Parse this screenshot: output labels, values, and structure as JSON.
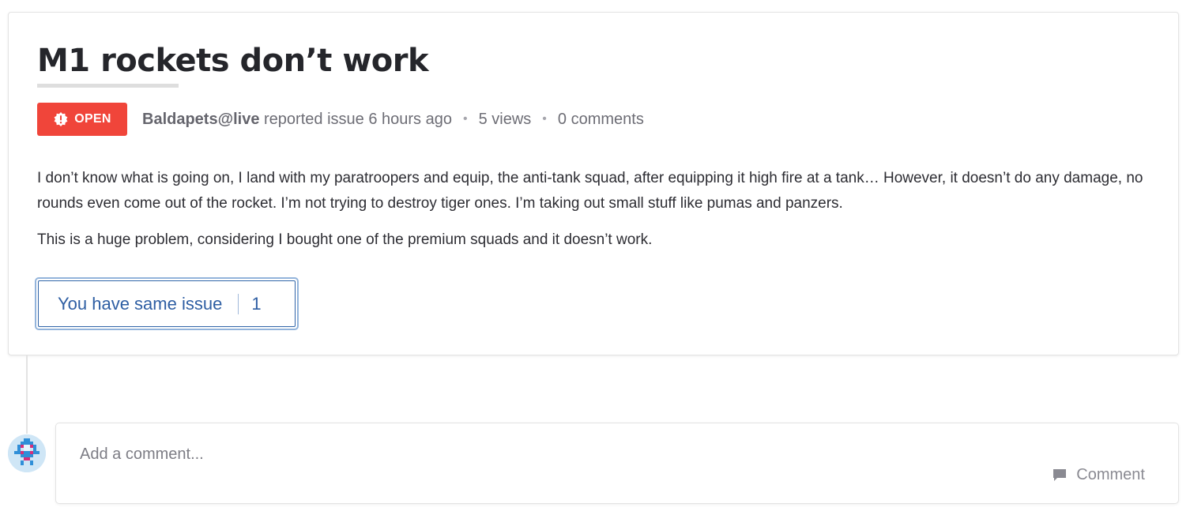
{
  "issue": {
    "title": "M1 rockets don’t work",
    "status_label": "OPEN",
    "status_color": "#f0453a",
    "author": "Baldapets@live",
    "action_text": "reported issue",
    "time_ago": "6 hours ago",
    "views": "5 views",
    "comments": "0 comments",
    "separator": "•",
    "body_paragraphs": [
      "I don’t know what is going on, I land with my paratroopers and equip, the anti-tank squad, after equipping it high fire at a tank… However, it doesn’t do any damage, no rounds even come out of the rocket. I’m not trying to destroy tiger ones. I’m taking out small stuff like pumas and panzers.",
      "This is a huge problem, considering I bought one of the premium squads and it doesn’t work."
    ]
  },
  "same_issue": {
    "label": "You have same issue",
    "count": "1",
    "accent": "#2e5ea3"
  },
  "comment_form": {
    "placeholder": "Add a comment...",
    "value": "",
    "submit_label": "Comment",
    "submit_icon": "speech-bubble-icon"
  },
  "avatar": {
    "icon": "pixel-robot-avatar"
  }
}
